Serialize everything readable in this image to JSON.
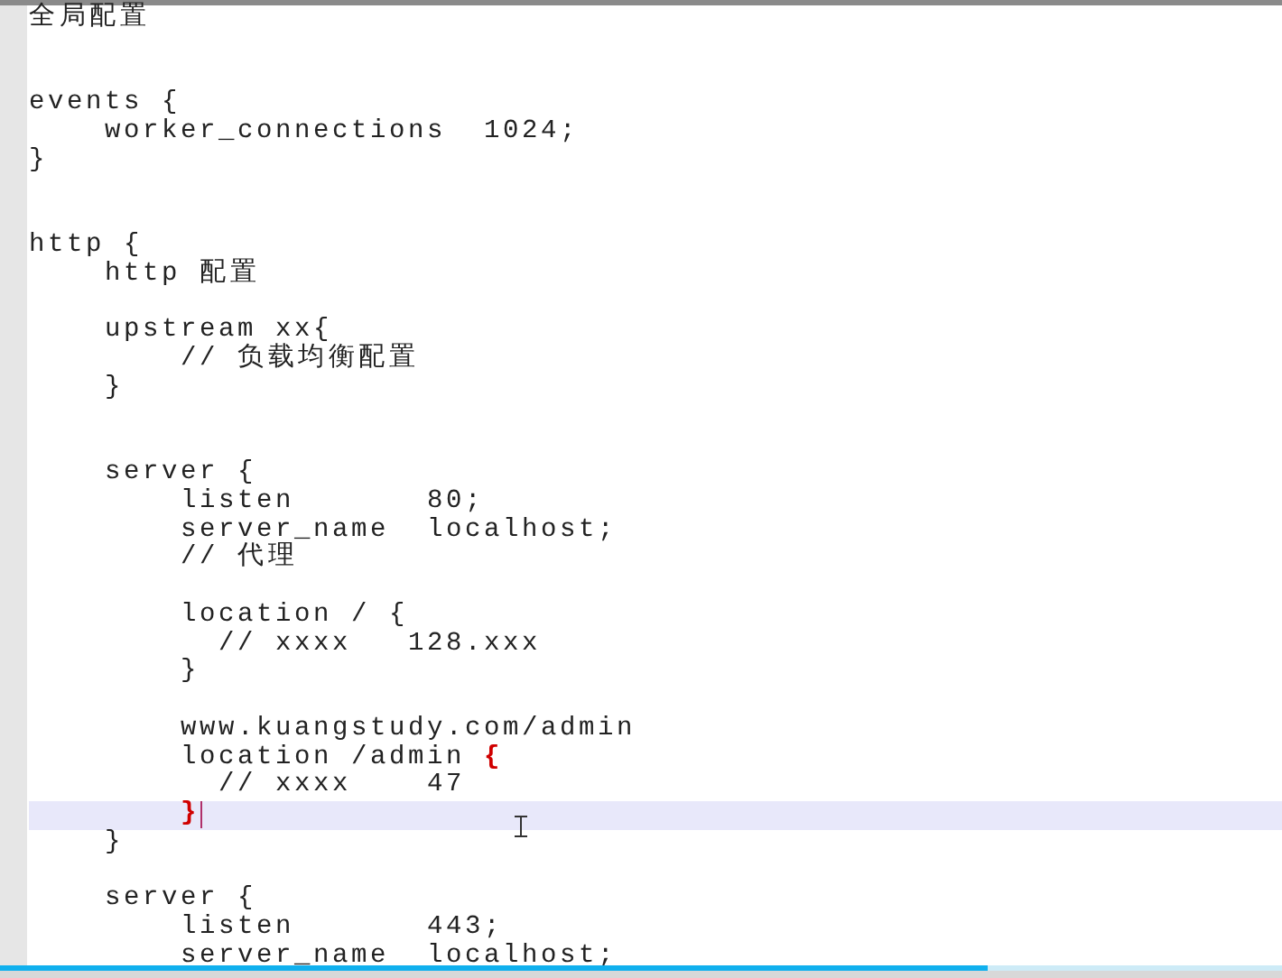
{
  "editor": {
    "lines": [
      {
        "kind": "code",
        "text": "全局配置",
        "current": false,
        "brace_match": false
      },
      {
        "kind": "blank"
      },
      {
        "kind": "blank"
      },
      {
        "kind": "code",
        "text": "events {",
        "current": false,
        "brace_match": false
      },
      {
        "kind": "code",
        "text": "    worker_connections  1024;",
        "current": false,
        "brace_match": false
      },
      {
        "kind": "code",
        "text": "}",
        "current": false,
        "brace_match": false
      },
      {
        "kind": "blank"
      },
      {
        "kind": "blank"
      },
      {
        "kind": "code",
        "text": "http {",
        "current": false,
        "brace_match": false
      },
      {
        "kind": "code",
        "text": "    http 配置",
        "current": false,
        "brace_match": false
      },
      {
        "kind": "blank"
      },
      {
        "kind": "code",
        "text": "    upstream xx{",
        "current": false,
        "brace_match": false
      },
      {
        "kind": "code",
        "text": "        // 负载均衡配置",
        "current": false,
        "brace_match": false
      },
      {
        "kind": "code",
        "text": "    }",
        "current": false,
        "brace_match": false
      },
      {
        "kind": "blank"
      },
      {
        "kind": "blank"
      },
      {
        "kind": "code",
        "text": "    server {",
        "current": false,
        "brace_match": false
      },
      {
        "kind": "code",
        "text": "        listen       80;",
        "current": false,
        "brace_match": false
      },
      {
        "kind": "code",
        "text": "        server_name  localhost;",
        "current": false,
        "brace_match": false
      },
      {
        "kind": "code",
        "text": "        // 代理",
        "current": false,
        "brace_match": false
      },
      {
        "kind": "blank"
      },
      {
        "kind": "code",
        "text": "        location / {",
        "current": false,
        "brace_match": false
      },
      {
        "kind": "code",
        "text": "          // xxxx   128.xxx",
        "current": false,
        "brace_match": false
      },
      {
        "kind": "code",
        "text": "        }",
        "current": false,
        "brace_match": false
      },
      {
        "kind": "blank"
      },
      {
        "kind": "code",
        "text": "        www.kuangstudy.com/admin",
        "current": false,
        "brace_match": false
      },
      {
        "kind": "code",
        "text": "        location /admin {",
        "current": false,
        "brace_match": true
      },
      {
        "kind": "code",
        "text": "          // xxxx    47",
        "current": false,
        "brace_match": false
      },
      {
        "kind": "code",
        "text": "        }",
        "current": true,
        "brace_match": true
      },
      {
        "kind": "code",
        "text": "    }",
        "current": false,
        "brace_match": false
      },
      {
        "kind": "blank"
      },
      {
        "kind": "code",
        "text": "    server {",
        "current": false,
        "brace_match": false
      },
      {
        "kind": "code",
        "text": "        listen       443;",
        "current": false,
        "brace_match": false
      },
      {
        "kind": "code",
        "text": "        server_name  localhost;",
        "current": false,
        "brace_match": false
      }
    ]
  },
  "video_progress": {
    "level": 0.77
  }
}
